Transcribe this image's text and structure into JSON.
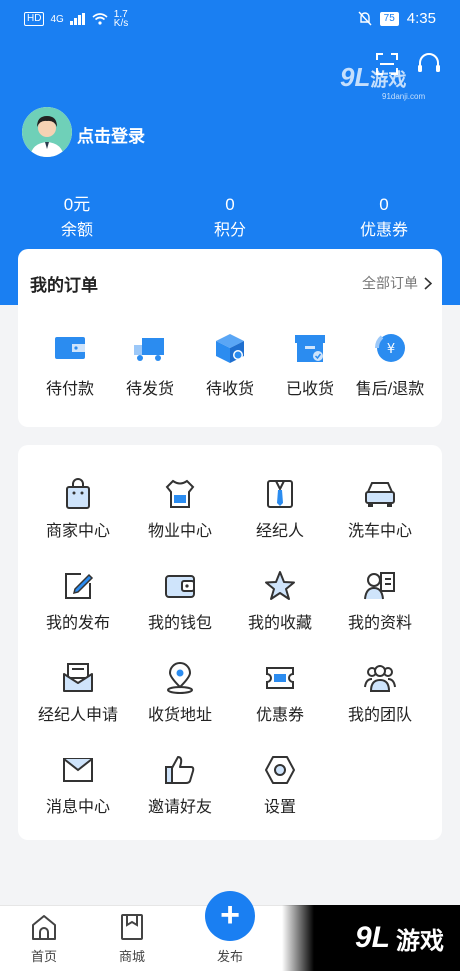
{
  "status_bar": {
    "hd": "HD",
    "network": "4G",
    "speed": "1.7",
    "speed_unit": "K/s",
    "battery": "75",
    "time": "4:35"
  },
  "watermark": {
    "logo": "9L",
    "text": "游戏",
    "url": "91danji.com"
  },
  "profile": {
    "login_label": "点击登录"
  },
  "stats": [
    {
      "value": "0元",
      "label": "余额"
    },
    {
      "value": "0",
      "label": "积分"
    },
    {
      "value": "0",
      "label": "优惠券"
    }
  ],
  "orders": {
    "title": "我的订单",
    "all_label": "全部订单",
    "items": [
      {
        "label": "待付款",
        "icon": "wallet-icon"
      },
      {
        "label": "待发货",
        "icon": "truck-icon"
      },
      {
        "label": "待收货",
        "icon": "package-icon"
      },
      {
        "label": "已收货",
        "icon": "received-box-icon"
      },
      {
        "label": "售后/退款",
        "icon": "refund-icon"
      }
    ]
  },
  "menu": {
    "items": [
      {
        "label": "商家中心",
        "icon": "shopping-bag-icon"
      },
      {
        "label": "物业中心",
        "icon": "uniform-icon"
      },
      {
        "label": "经纪人",
        "icon": "agent-icon"
      },
      {
        "label": "洗车中心",
        "icon": "car-icon"
      },
      {
        "label": "我的发布",
        "icon": "edit-icon"
      },
      {
        "label": "我的钱包",
        "icon": "wallet-icon"
      },
      {
        "label": "我的收藏",
        "icon": "star-icon"
      },
      {
        "label": "我的资料",
        "icon": "profile-card-icon"
      },
      {
        "label": "经纪人申请",
        "icon": "mail-apply-icon"
      },
      {
        "label": "收货地址",
        "icon": "location-icon"
      },
      {
        "label": "优惠券",
        "icon": "coupon-icon"
      },
      {
        "label": "我的团队",
        "icon": "team-icon"
      },
      {
        "label": "消息中心",
        "icon": "envelope-icon"
      },
      {
        "label": "邀请好友",
        "icon": "thumbs-up-icon"
      },
      {
        "label": "设置",
        "icon": "settings-icon"
      }
    ]
  },
  "tabbar": {
    "home": "首页",
    "mall": "商城",
    "publish": "发布",
    "publish_symbol": "+"
  },
  "colors": {
    "brand": "#1a7ff2",
    "icon_accent": "#2b8cf0",
    "icon_dark": "#333333"
  }
}
